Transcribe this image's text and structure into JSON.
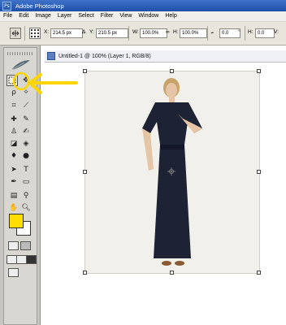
{
  "window": {
    "title": "Adobe Photoshop",
    "app_icon": "photoshop-icon"
  },
  "menubar": {
    "items": [
      {
        "label": "File"
      },
      {
        "label": "Edit"
      },
      {
        "label": "Image"
      },
      {
        "label": "Layer"
      },
      {
        "label": "Select"
      },
      {
        "label": "Filter"
      },
      {
        "label": "View"
      },
      {
        "label": "Window"
      },
      {
        "label": "Help"
      }
    ]
  },
  "options_bar": {
    "x_label": "X:",
    "x_value": "214.5 px",
    "delta_label": "Δ",
    "y_label": "Y:",
    "y_value": "210.5 px",
    "w_label": "W:",
    "w_value": "100.0%",
    "h_label": "H:",
    "h_value": "100.0%",
    "angle_value": "0.0",
    "angle_unit": "°",
    "hskew_label": "H:",
    "hskew_value": "0.0",
    "vskew_label": "V:",
    "vskew_value": "0.0"
  },
  "document": {
    "tab_title": "Untitled-1 @ 100% (Layer 1, RGB/8)"
  },
  "colors": {
    "foreground": "#ffdd00",
    "background": "#ffffff",
    "annotation": "#ffd500"
  }
}
